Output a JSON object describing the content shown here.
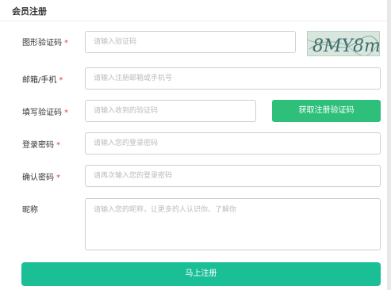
{
  "page": {
    "title": "会员注册"
  },
  "form": {
    "captcha": {
      "label": "图形验证码",
      "required": "*",
      "placeholder": "请输入验证码",
      "image_text": "8MY8m"
    },
    "account": {
      "label": "邮箱/手机",
      "required": "*",
      "placeholder": "请输入注册邮箱或手机号"
    },
    "verify_code": {
      "label": "填写验证码",
      "required": "*",
      "placeholder": "请输入收到的验证码",
      "button": "获取注册验证码"
    },
    "password": {
      "label": "登录密码",
      "required": "*",
      "placeholder": "请输入您的登录密码"
    },
    "confirm_password": {
      "label": "确认密码",
      "required": "*",
      "placeholder": "请再次输入您的登录密码"
    },
    "nickname": {
      "label": "昵称",
      "placeholder": "请输入您的昵称，让更多的人认识你、了解你"
    },
    "submit": "马上注册"
  },
  "colors": {
    "accent_green": "#2ec07a",
    "submit_teal": "#1bbf95",
    "required_red": "#e4393c"
  }
}
